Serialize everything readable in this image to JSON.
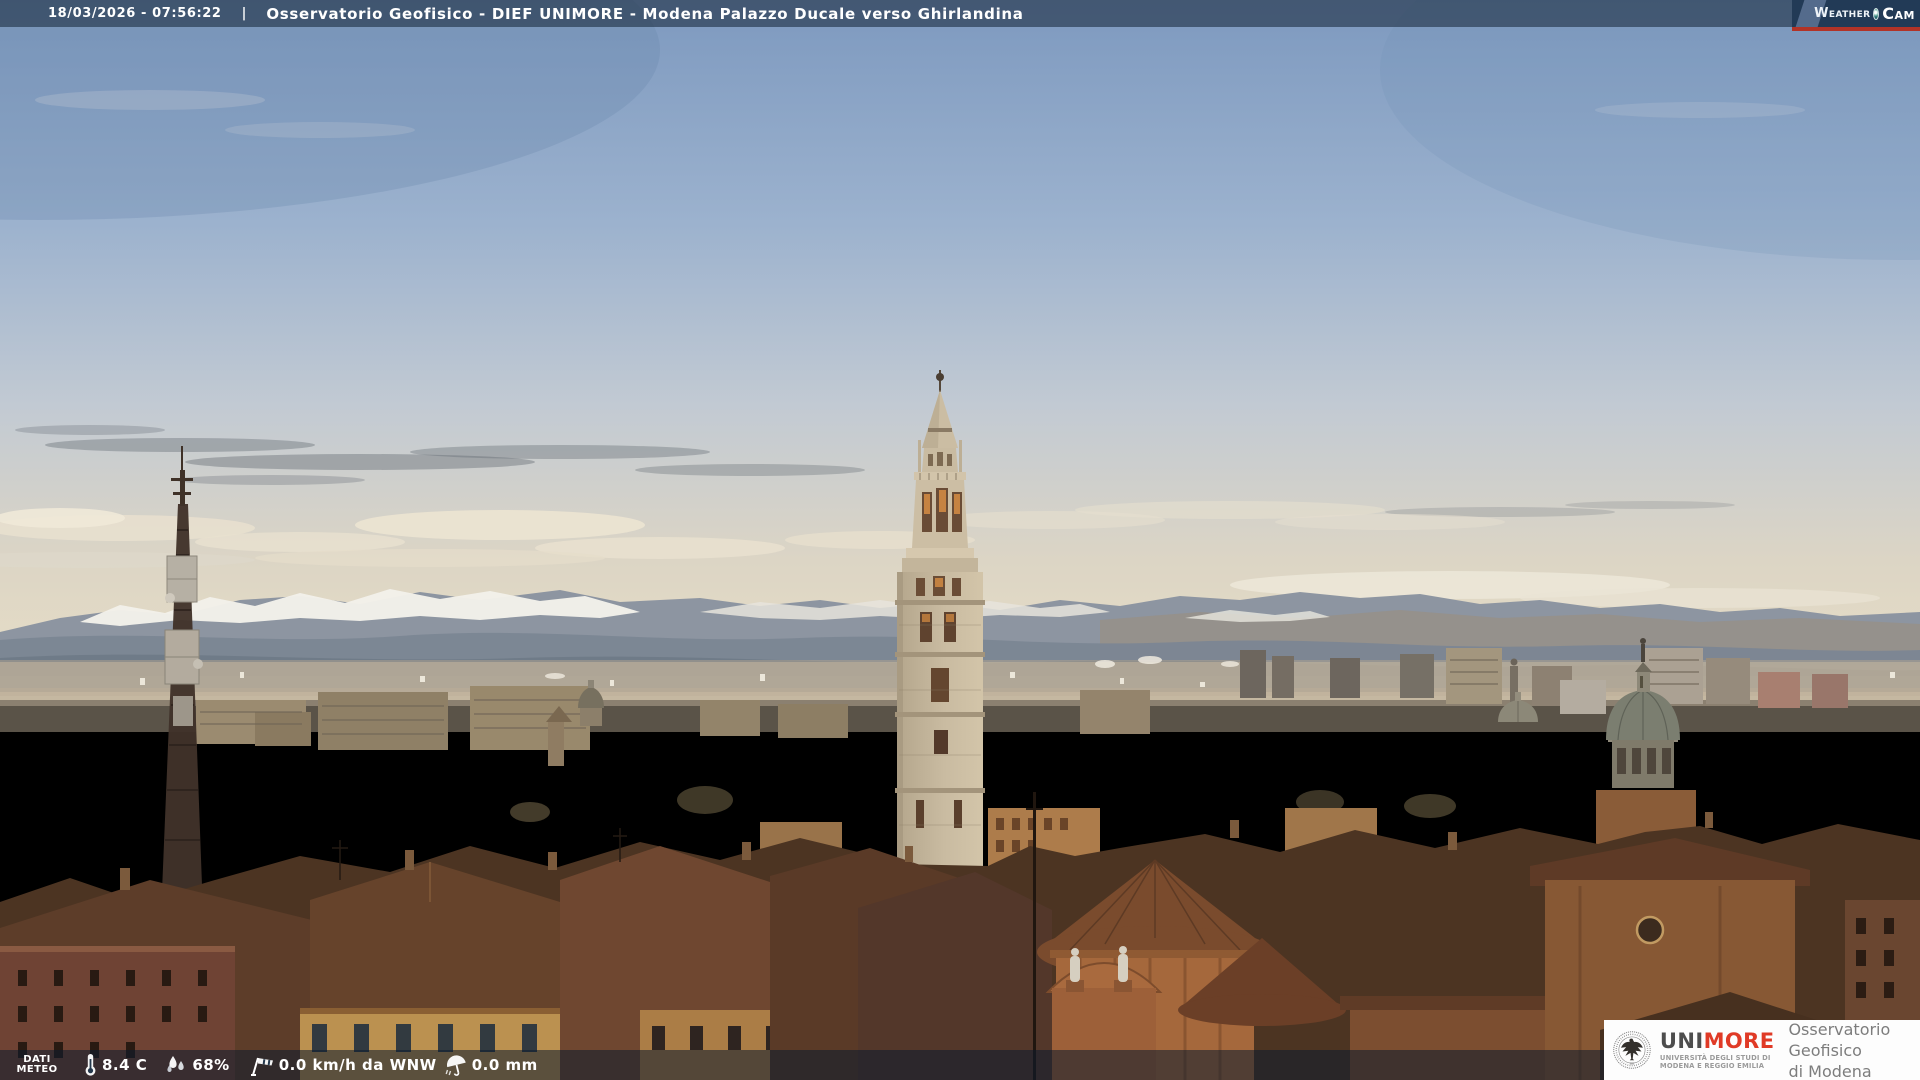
{
  "header": {
    "datetime": "18/03/2026 - 07:56:22",
    "separator": "|",
    "title": "Osservatorio Geofisico - DIEF UNIMORE - Modena Palazzo Ducale verso Ghirlandina"
  },
  "watermark": {
    "weather": "Weather",
    "cam": "Cam"
  },
  "weather_bar": {
    "label_line1": "DATI",
    "label_line2": "METEO",
    "temperature": "8.4 C",
    "humidity": "68%",
    "wind": "0.0 km/h da WNW",
    "precipitation": "0.0 mm"
  },
  "unimore": {
    "uni": "UNI",
    "more": "MORE",
    "sub1": "UNIVERSITÀ DEGLI STUDI DI",
    "sub2": "MODENA E REGGIO EMILIA",
    "org1": "Osservatorio Geofisico",
    "org2": "di Modena"
  },
  "icons": {
    "thermometer": "thermometer-icon",
    "humidity": "water-drops-icon",
    "wind": "windsock-icon",
    "precipitation": "umbrella-icon",
    "lens": "camera-lens-icon",
    "seal": "unimore-seal-icon"
  },
  "colors": {
    "overlay_bar": "rgba(13,28,46,0.55)",
    "weathercam_navy": "#223a56",
    "weathercam_red": "#b23327",
    "unimore_red": "#e03a26",
    "text_white": "#ffffff"
  }
}
